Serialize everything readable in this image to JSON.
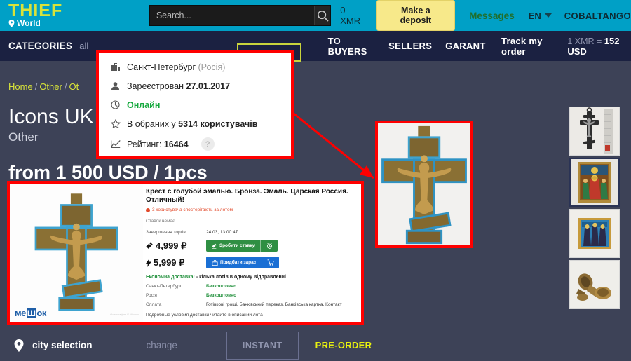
{
  "header": {
    "logo_main": "THIEF",
    "logo_sub": "World",
    "logo_pin_icon": "map-pin-icon",
    "search_placeholder": "Search...",
    "search_value": "",
    "search_icon": "search-icon",
    "balance": "0 XMR",
    "deposit_label": "Make a deposit",
    "messages_label": "Messages",
    "language": "EN",
    "language_caret_icon": "chevron-down-icon",
    "username": "COBALTANGO"
  },
  "nav": {
    "categories_label": "CATEGORIES",
    "all_label": "all",
    "items": [
      {
        "label": "TO BUYERS"
      },
      {
        "label": "SELLERS"
      },
      {
        "label": "GARANT"
      },
      {
        "label": "Track my order"
      }
    ],
    "rate_prefix": "1 XMR = ",
    "rate_value": "152 USD"
  },
  "breadcrumb": {
    "home": "Home",
    "sep": "/",
    "level1": "Other",
    "level2": "Ot"
  },
  "page": {
    "title": "Icons UK",
    "subtitle": "Other",
    "price_line": "from 1 500 USD / 1pcs"
  },
  "seller_popup": {
    "rows": [
      {
        "icon": "building-icon",
        "text": "Санкт-Петербург",
        "muted": " (Росія)",
        "style": "normal"
      },
      {
        "icon": "person-icon",
        "label": "Зареєстрован ",
        "value": "27.01.2017",
        "style": "bold-value"
      },
      {
        "icon": "clock-icon",
        "text": "Онлайн",
        "style": "green"
      },
      {
        "icon": "star-icon",
        "label": "В обраних у ",
        "value": "5314 користувачів",
        "style": "bold-value"
      },
      {
        "icon": "chart-icon",
        "label": "Рейтинг: ",
        "value": "16464",
        "style": "bold-value",
        "help": "?"
      }
    ]
  },
  "listing_card": {
    "photo_alt": "bronze-orthodox-cross-blue-enamel",
    "watermark_brand": "ме",
    "watermark_box": "Ш",
    "watermark_brand2": "ок",
    "watermark_small": "Фотография © Мешок",
    "title": "Крест с голубой эмалью. Бронза. Эмаль. Царская Россия. Отличный!",
    "watchers": "3 користувача спостерігають за лотом",
    "no_bids": "Ставок немає",
    "end_label": "Завершення торгів",
    "end_value": "24.03, 13:00:47",
    "bid_price": "4,999 ₽",
    "bid_icon": "gavel-icon",
    "bid_button": "Зробити ставку",
    "bid_side_icon": "alarm-clock-icon",
    "buy_price": "5,999 ₽",
    "buy_icon": "lightning-icon",
    "buy_button": "Придбати зараз",
    "buy_side_icon": "cart-icon",
    "shipping_highlight": "Економна доставка!",
    "shipping_rest": " - кілька лотів в одному відправленні",
    "ship_rows": [
      {
        "k": "Санкт-Петербург",
        "v": "Безкоштовно",
        "green": true
      },
      {
        "k": "Росія",
        "v": "Безкоштовно",
        "green": true
      },
      {
        "k": "Оплата",
        "v": "Готівкові гроші, Банківський переказ, Банківська картка, Контакт",
        "green": false
      }
    ],
    "note": "Подробные условия доставки читайте в описании лота"
  },
  "zoom_panel": {
    "alt": "zoomed-bronze-cross"
  },
  "thumbnails": [
    {
      "name": "thumb-silver-cross-with-ruler",
      "selected": false
    },
    {
      "name": "thumb-icon-painting",
      "selected": true
    },
    {
      "name": "thumb-blue-icon",
      "selected": false
    },
    {
      "name": "thumb-metal-vessels",
      "selected": false
    }
  ],
  "bottombar": {
    "city_icon": "map-pin-icon",
    "city_label": "city selection",
    "change_label": "change",
    "instant_label": "INSTANT",
    "preorder_label": "PRE-ORDER"
  },
  "colors": {
    "topbar": "#00a0c6",
    "navbar": "#1b2141",
    "page_bg": "#3d4257",
    "accent_yellow": "#d8e33a",
    "highlight_red": "#ff0000",
    "green": "#2f8f43",
    "blue": "#1a6fd4",
    "preorder_yellow": "#e9f20f"
  }
}
